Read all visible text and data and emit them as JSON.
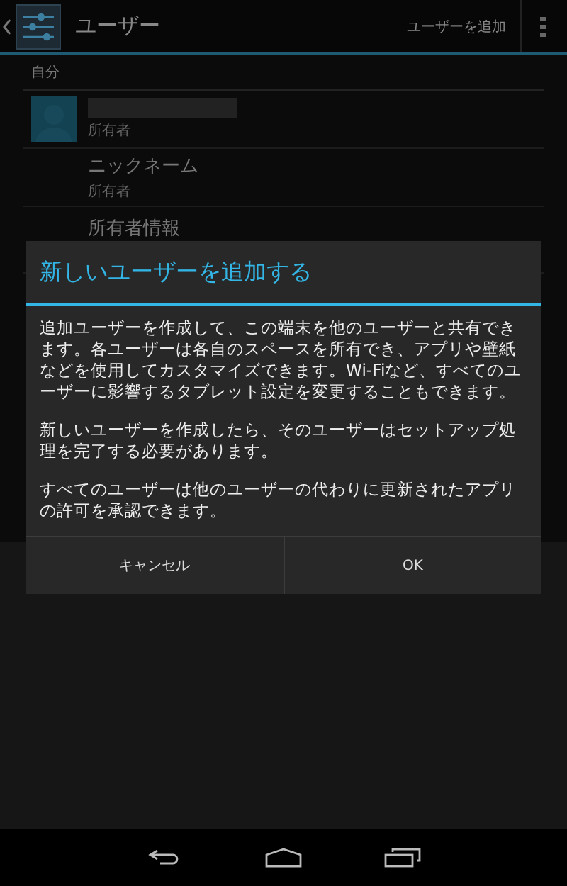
{
  "action_bar": {
    "title": "ユーザー",
    "action": "ユーザーを追加"
  },
  "section": {
    "header": "自分"
  },
  "users": [
    {
      "kind": "profile",
      "subtitle": "所有者"
    },
    {
      "kind": "text",
      "title": "ニックネーム",
      "subtitle": "所有者"
    },
    {
      "kind": "text",
      "title": "所有者情報"
    }
  ],
  "dialog": {
    "title": "新しいユーザーを追加する",
    "paragraphs": [
      "追加ユーザーを作成して、この端末を他のユーザーと共有できます。各ユーザーは各自のスペースを所有でき、アプリや壁紙などを使用してカスタマイズできます。Wi-Fiなど、すべてのユーザーに影響するタブレット設定を変更することもできます。",
      "新しいユーザーを作成したら、そのユーザーはセットアップ処理を完了する必要があります。",
      "すべてのユーザーは他のユーザーの代わりに更新されたアプリの許可を承認できます。"
    ],
    "buttons": [
      "キャンセル",
      "OK"
    ]
  }
}
